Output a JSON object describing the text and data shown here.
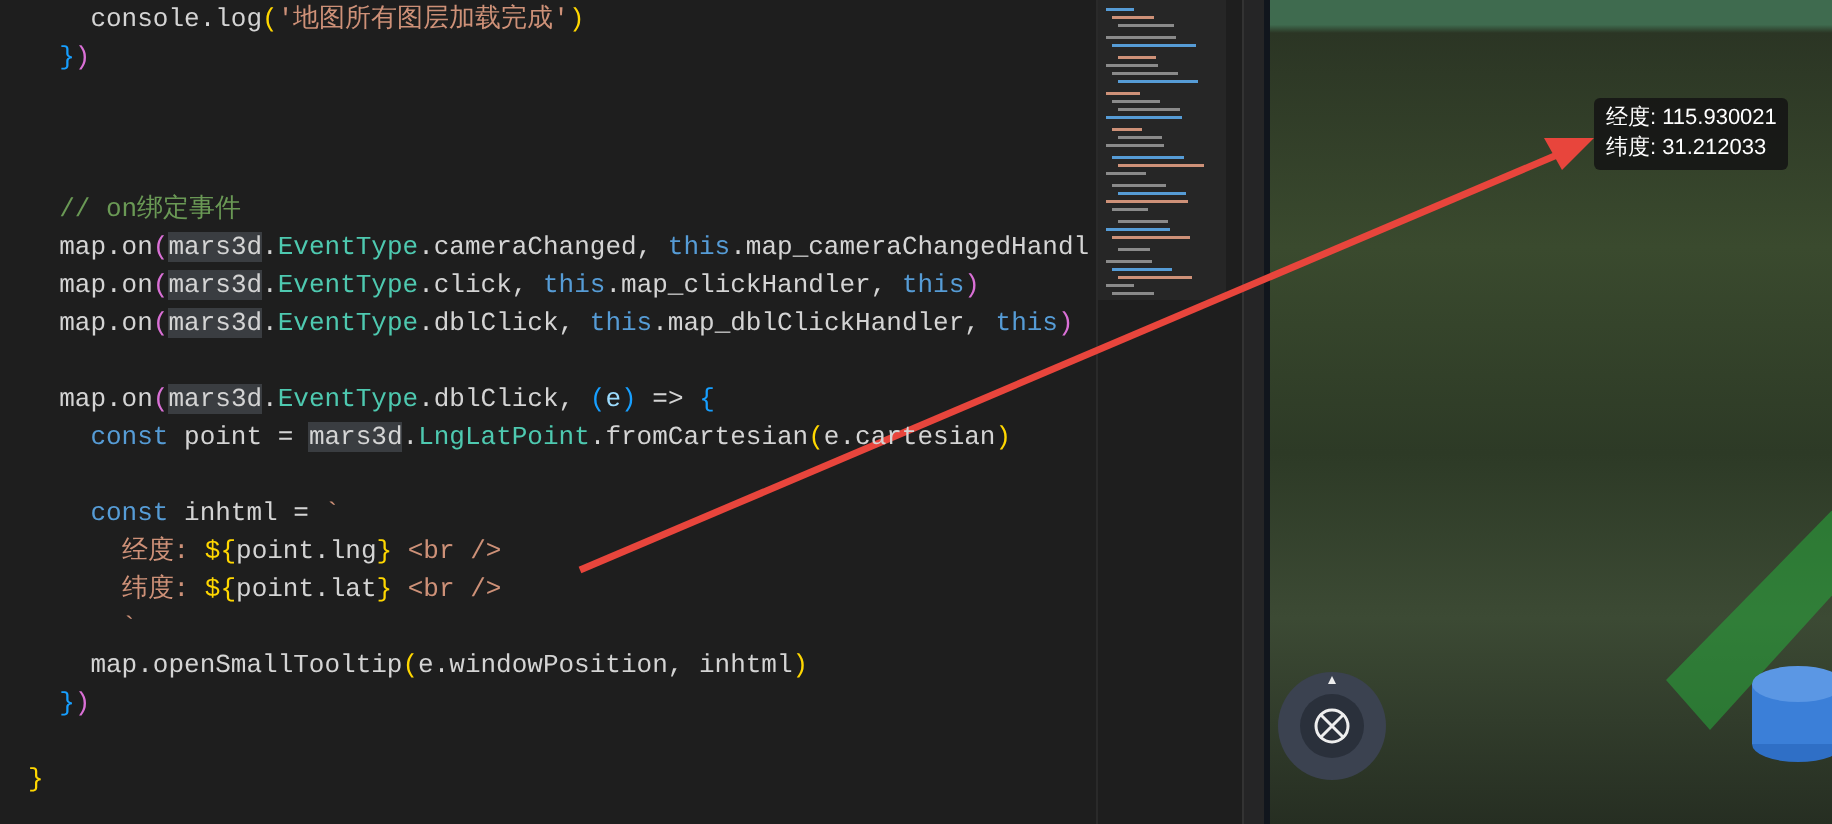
{
  "editor": {
    "lines": [
      {
        "kind": "code",
        "tokens": [
          {
            "t": "    console.log",
            "kind": "plain"
          },
          {
            "t": "(",
            "kind": "b1"
          },
          {
            "t": "'地图所有图层加载完成'",
            "kind": "string"
          },
          {
            "t": ")",
            "kind": "b1"
          }
        ]
      },
      {
        "kind": "code",
        "tokens": [
          {
            "t": "  }",
            "kind": "b3"
          },
          {
            "t": ")",
            "kind": "b2"
          }
        ]
      },
      {
        "kind": "blank"
      },
      {
        "kind": "blank"
      },
      {
        "kind": "blank"
      },
      {
        "kind": "code",
        "tokens": [
          {
            "t": "  // on绑定事件",
            "kind": "comment"
          }
        ]
      },
      {
        "kind": "code",
        "tokens": [
          {
            "t": "  map.on",
            "kind": "plain"
          },
          {
            "t": "(",
            "kind": "b2"
          },
          {
            "t": "mars3d",
            "kind": "match"
          },
          {
            "t": ".",
            "kind": "plain"
          },
          {
            "t": "EventType",
            "kind": "type"
          },
          {
            "t": ".cameraChanged, ",
            "kind": "plain"
          },
          {
            "t": "this",
            "kind": "keyword"
          },
          {
            "t": ".map_cameraChangedHandl",
            "kind": "plain"
          }
        ]
      },
      {
        "kind": "code",
        "tokens": [
          {
            "t": "  map.on",
            "kind": "plain"
          },
          {
            "t": "(",
            "kind": "b2"
          },
          {
            "t": "mars3d",
            "kind": "match"
          },
          {
            "t": ".",
            "kind": "plain"
          },
          {
            "t": "EventType",
            "kind": "type"
          },
          {
            "t": ".click, ",
            "kind": "plain"
          },
          {
            "t": "this",
            "kind": "keyword"
          },
          {
            "t": ".map_clickHandler, ",
            "kind": "plain"
          },
          {
            "t": "this",
            "kind": "keyword"
          },
          {
            "t": ")",
            "kind": "b2"
          }
        ]
      },
      {
        "kind": "code",
        "tokens": [
          {
            "t": "  map.on",
            "kind": "plain"
          },
          {
            "t": "(",
            "kind": "b2"
          },
          {
            "t": "mars3d",
            "kind": "match"
          },
          {
            "t": ".",
            "kind": "plain"
          },
          {
            "t": "EventType",
            "kind": "type"
          },
          {
            "t": ".dblClick, ",
            "kind": "plain"
          },
          {
            "t": "this",
            "kind": "keyword"
          },
          {
            "t": ".map_dblClickHandler, ",
            "kind": "plain"
          },
          {
            "t": "this",
            "kind": "keyword"
          },
          {
            "t": ")",
            "kind": "b2"
          }
        ]
      },
      {
        "kind": "blank"
      },
      {
        "kind": "code",
        "tokens": [
          {
            "t": "  map.on",
            "kind": "plain"
          },
          {
            "t": "(",
            "kind": "b2"
          },
          {
            "t": "mars3d",
            "kind": "match"
          },
          {
            "t": ".",
            "kind": "plain"
          },
          {
            "t": "EventType",
            "kind": "type"
          },
          {
            "t": ".dblClick, ",
            "kind": "plain"
          },
          {
            "t": "(",
            "kind": "b3"
          },
          {
            "t": "e",
            "kind": "param"
          },
          {
            "t": ")",
            "kind": "b3"
          },
          {
            "t": " => ",
            "kind": "plain"
          },
          {
            "t": "{",
            "kind": "b3"
          }
        ]
      },
      {
        "kind": "code",
        "tokens": [
          {
            "t": "    const",
            "kind": "keyword"
          },
          {
            "t": " point = ",
            "kind": "plain"
          },
          {
            "t": "mars3d",
            "kind": "match"
          },
          {
            "t": ".",
            "kind": "plain"
          },
          {
            "t": "LngLatPoint",
            "kind": "type"
          },
          {
            "t": ".fromCartesian",
            "kind": "plain"
          },
          {
            "t": "(",
            "kind": "b1"
          },
          {
            "t": "e.cartesian",
            "kind": "plain"
          },
          {
            "t": ")",
            "kind": "b1"
          }
        ]
      },
      {
        "kind": "blank"
      },
      {
        "kind": "code",
        "tokens": [
          {
            "t": "    const",
            "kind": "keyword"
          },
          {
            "t": " inhtml = ",
            "kind": "plain"
          },
          {
            "t": "`",
            "kind": "string"
          }
        ]
      },
      {
        "kind": "code",
        "tokens": [
          {
            "t": "      经度: ",
            "kind": "string"
          },
          {
            "t": "${",
            "kind": "b1"
          },
          {
            "t": "point.lng",
            "kind": "plain"
          },
          {
            "t": "}",
            "kind": "b1"
          },
          {
            "t": " <br />",
            "kind": "string"
          }
        ]
      },
      {
        "kind": "code",
        "tokens": [
          {
            "t": "      纬度: ",
            "kind": "string"
          },
          {
            "t": "${",
            "kind": "b1"
          },
          {
            "t": "point.lat",
            "kind": "plain"
          },
          {
            "t": "}",
            "kind": "b1"
          },
          {
            "t": " <br />",
            "kind": "string"
          }
        ]
      },
      {
        "kind": "code",
        "tokens": [
          {
            "t": "      `",
            "kind": "string"
          }
        ]
      },
      {
        "kind": "code",
        "tokens": [
          {
            "t": "    map.openSmallTooltip",
            "kind": "plain"
          },
          {
            "t": "(",
            "kind": "b1"
          },
          {
            "t": "e.windowPosition, inhtml",
            "kind": "plain"
          },
          {
            "t": ")",
            "kind": "b1"
          }
        ]
      },
      {
        "kind": "code",
        "tokens": [
          {
            "t": "  }",
            "kind": "b3"
          },
          {
            "t": ")",
            "kind": "b2"
          }
        ]
      },
      {
        "kind": "blank"
      },
      {
        "kind": "code",
        "tokens": [
          {
            "t": "}",
            "kind": "b1"
          }
        ]
      }
    ]
  },
  "map": {
    "tooltip": {
      "lines": [
        "经度: 115.930021",
        "纬度: 31.212033"
      ]
    }
  }
}
